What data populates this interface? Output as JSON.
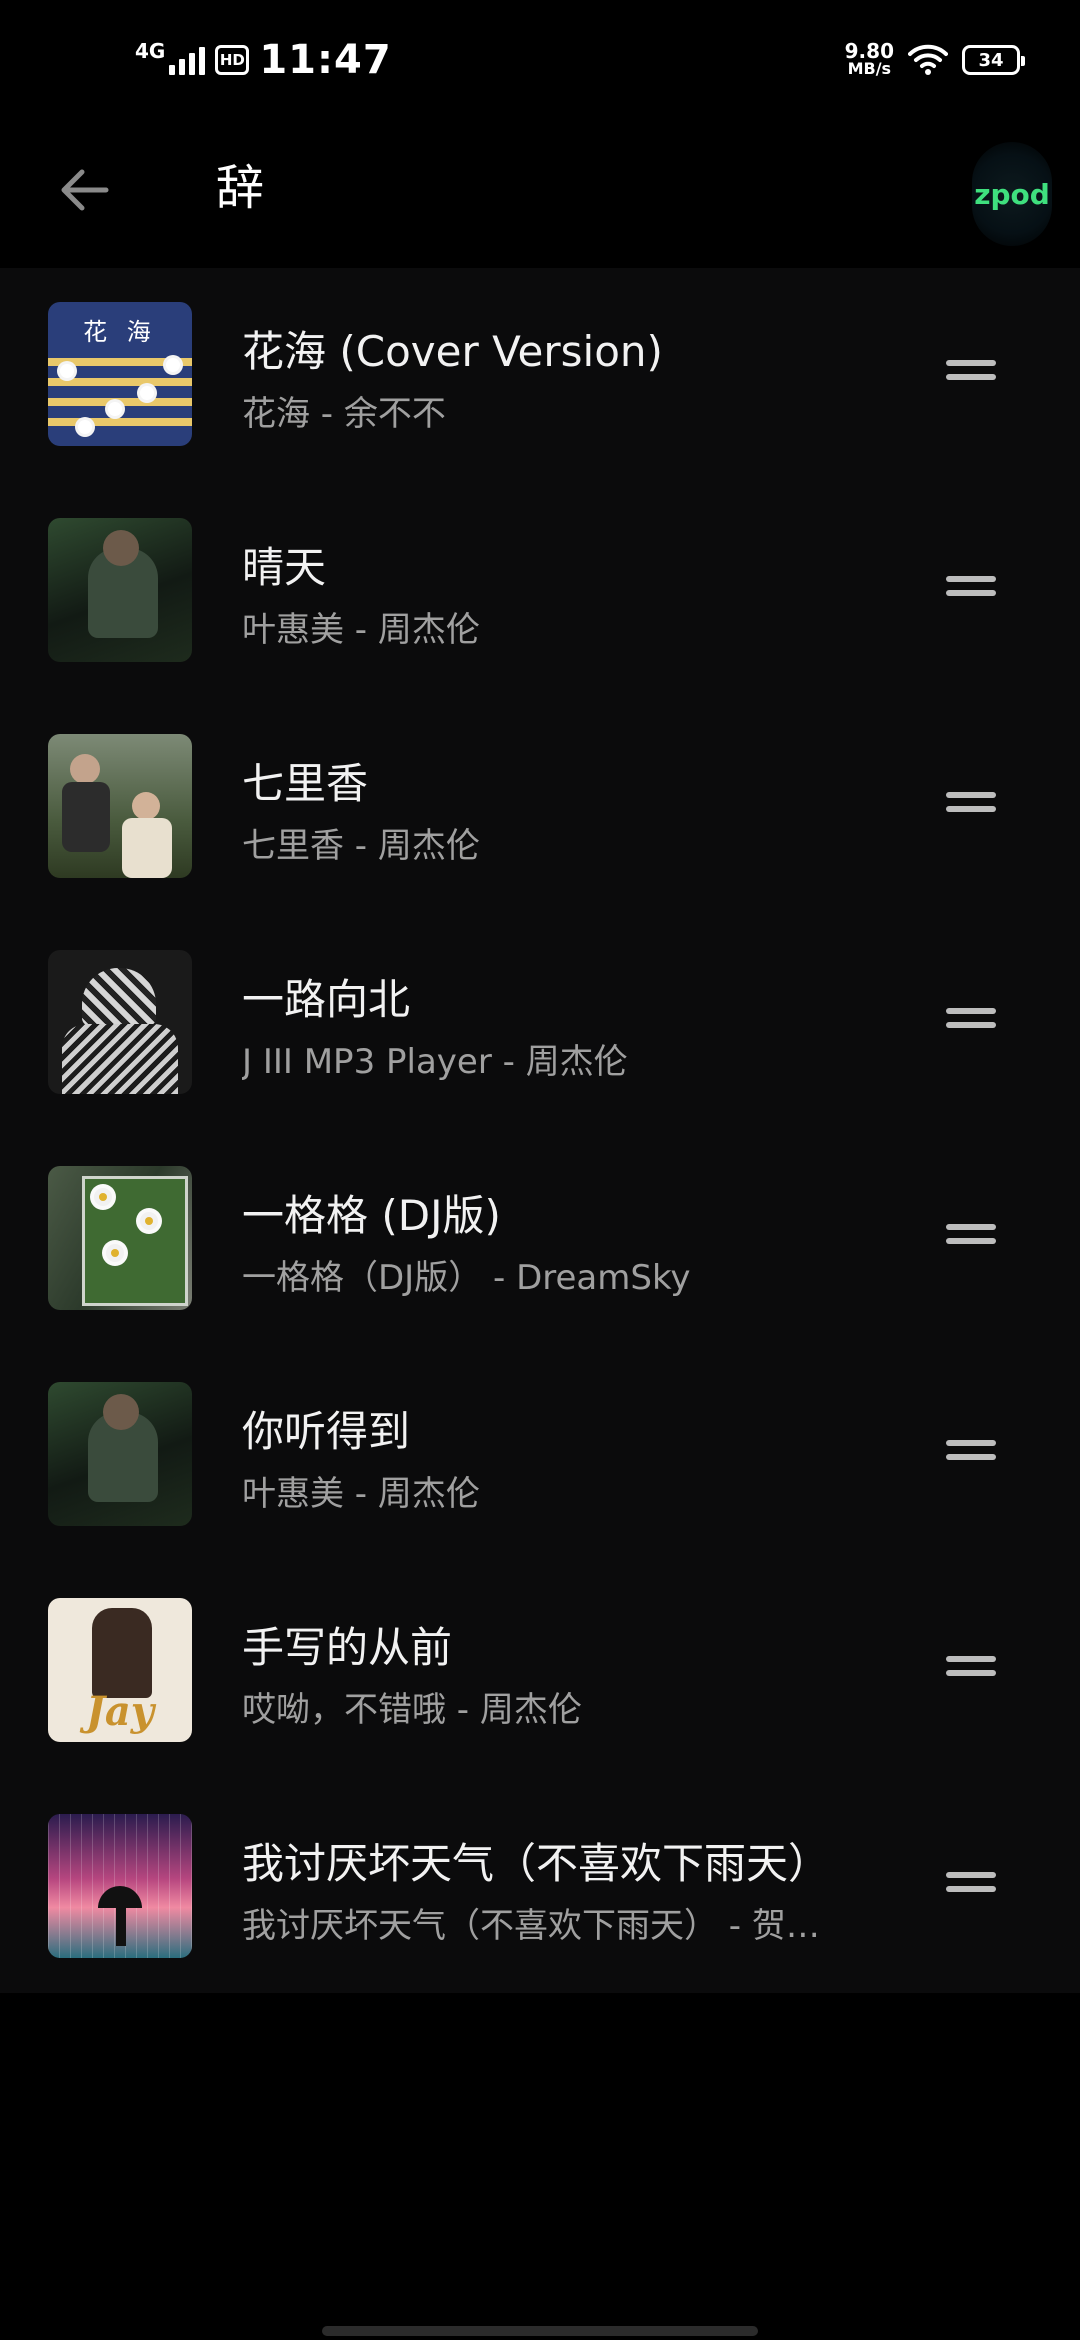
{
  "status_bar": {
    "network": "4G",
    "hd": "HD",
    "time": "11:47",
    "speed_value": "9.80",
    "speed_unit": "MB/s",
    "battery": "34"
  },
  "header": {
    "title": "辞",
    "avatar_label": "zpod"
  },
  "songs": [
    {
      "title": "花海 (Cover Version)",
      "subtitle": "花海 - 余不不",
      "cover": "huahai-cover",
      "cover_text": "花 海"
    },
    {
      "title": "晴天",
      "subtitle": "叶惠美 - 周杰伦",
      "cover": "ye-hui-mei-cover"
    },
    {
      "title": "七里香",
      "subtitle": "七里香 - 周杰伦",
      "cover": "qi-li-xiang-cover"
    },
    {
      "title": "一路向北",
      "subtitle": "J III MP3 Player - 周杰伦",
      "cover": "j3-cover"
    },
    {
      "title": "一格格 (DJ版)",
      "subtitle": "一格格（DJ版） - DreamSky",
      "cover": "daisy-window-cover"
    },
    {
      "title": "你听得到",
      "subtitle": "叶惠美 - 周杰伦",
      "cover": "ye-hui-mei-cover"
    },
    {
      "title": "手写的从前",
      "subtitle": "哎呦，不错哦 - 周杰伦",
      "cover": "aiyou-cover",
      "cover_text": "Jay"
    },
    {
      "title": "我讨厌坏天气（不喜欢下雨天）",
      "subtitle": "我讨厌坏天气（不喜欢下雨天） - 贺…",
      "cover": "rainy-day-cover"
    }
  ],
  "colors": {
    "background": "#000000",
    "list_background": "#0b0b0c",
    "title_text": "#f2f2f2",
    "subtitle_text": "#a0a0a0",
    "accent_avatar_text": "#3fe07e"
  }
}
